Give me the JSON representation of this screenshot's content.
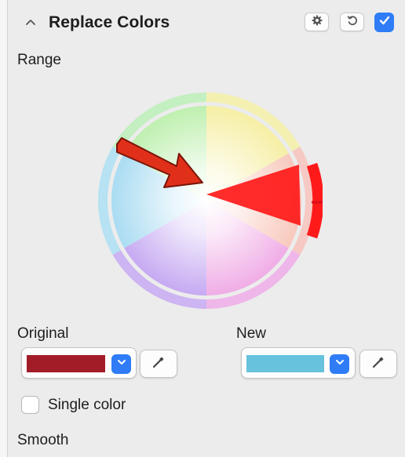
{
  "panel": {
    "title": "Replace Colors",
    "enabled": true
  },
  "range": {
    "label": "Range"
  },
  "original": {
    "label": "Original",
    "color": "#a21c28"
  },
  "new_color": {
    "label": "New",
    "color": "#66c2dd"
  },
  "single_color": {
    "label": "Single color",
    "checked": false
  },
  "smooth": {
    "label": "Smooth"
  },
  "colors": {
    "accent": "#2f7cf6",
    "range_red": "#ff1a1a",
    "arrow_red": "#e0301a"
  },
  "icons": {
    "collapse": "chevron-up-icon",
    "settings": "gear-icon",
    "reset": "reset-icon",
    "dropdown": "chevron-down-icon",
    "eyedropper": "eyedropper-icon"
  }
}
